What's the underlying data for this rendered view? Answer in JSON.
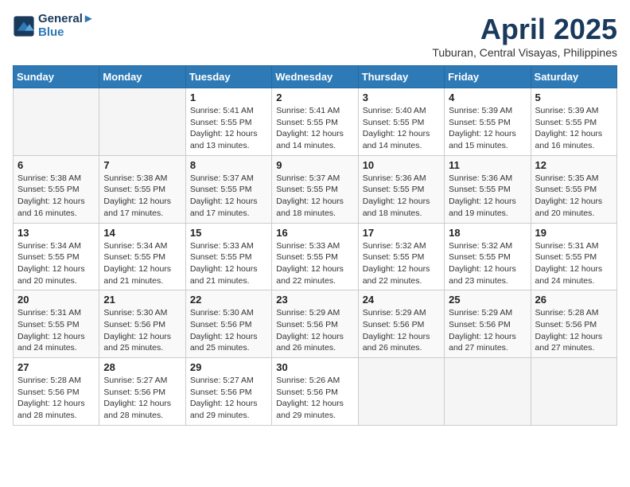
{
  "header": {
    "logo_line1": "General",
    "logo_line2": "Blue",
    "month": "April 2025",
    "location": "Tuburan, Central Visayas, Philippines"
  },
  "weekdays": [
    "Sunday",
    "Monday",
    "Tuesday",
    "Wednesday",
    "Thursday",
    "Friday",
    "Saturday"
  ],
  "weeks": [
    [
      {
        "day": "",
        "info": ""
      },
      {
        "day": "",
        "info": ""
      },
      {
        "day": "1",
        "info": "Sunrise: 5:41 AM\nSunset: 5:55 PM\nDaylight: 12 hours and 13 minutes."
      },
      {
        "day": "2",
        "info": "Sunrise: 5:41 AM\nSunset: 5:55 PM\nDaylight: 12 hours and 14 minutes."
      },
      {
        "day": "3",
        "info": "Sunrise: 5:40 AM\nSunset: 5:55 PM\nDaylight: 12 hours and 14 minutes."
      },
      {
        "day": "4",
        "info": "Sunrise: 5:39 AM\nSunset: 5:55 PM\nDaylight: 12 hours and 15 minutes."
      },
      {
        "day": "5",
        "info": "Sunrise: 5:39 AM\nSunset: 5:55 PM\nDaylight: 12 hours and 16 minutes."
      }
    ],
    [
      {
        "day": "6",
        "info": "Sunrise: 5:38 AM\nSunset: 5:55 PM\nDaylight: 12 hours and 16 minutes."
      },
      {
        "day": "7",
        "info": "Sunrise: 5:38 AM\nSunset: 5:55 PM\nDaylight: 12 hours and 17 minutes."
      },
      {
        "day": "8",
        "info": "Sunrise: 5:37 AM\nSunset: 5:55 PM\nDaylight: 12 hours and 17 minutes."
      },
      {
        "day": "9",
        "info": "Sunrise: 5:37 AM\nSunset: 5:55 PM\nDaylight: 12 hours and 18 minutes."
      },
      {
        "day": "10",
        "info": "Sunrise: 5:36 AM\nSunset: 5:55 PM\nDaylight: 12 hours and 18 minutes."
      },
      {
        "day": "11",
        "info": "Sunrise: 5:36 AM\nSunset: 5:55 PM\nDaylight: 12 hours and 19 minutes."
      },
      {
        "day": "12",
        "info": "Sunrise: 5:35 AM\nSunset: 5:55 PM\nDaylight: 12 hours and 20 minutes."
      }
    ],
    [
      {
        "day": "13",
        "info": "Sunrise: 5:34 AM\nSunset: 5:55 PM\nDaylight: 12 hours and 20 minutes."
      },
      {
        "day": "14",
        "info": "Sunrise: 5:34 AM\nSunset: 5:55 PM\nDaylight: 12 hours and 21 minutes."
      },
      {
        "day": "15",
        "info": "Sunrise: 5:33 AM\nSunset: 5:55 PM\nDaylight: 12 hours and 21 minutes."
      },
      {
        "day": "16",
        "info": "Sunrise: 5:33 AM\nSunset: 5:55 PM\nDaylight: 12 hours and 22 minutes."
      },
      {
        "day": "17",
        "info": "Sunrise: 5:32 AM\nSunset: 5:55 PM\nDaylight: 12 hours and 22 minutes."
      },
      {
        "day": "18",
        "info": "Sunrise: 5:32 AM\nSunset: 5:55 PM\nDaylight: 12 hours and 23 minutes."
      },
      {
        "day": "19",
        "info": "Sunrise: 5:31 AM\nSunset: 5:55 PM\nDaylight: 12 hours and 24 minutes."
      }
    ],
    [
      {
        "day": "20",
        "info": "Sunrise: 5:31 AM\nSunset: 5:55 PM\nDaylight: 12 hours and 24 minutes."
      },
      {
        "day": "21",
        "info": "Sunrise: 5:30 AM\nSunset: 5:56 PM\nDaylight: 12 hours and 25 minutes."
      },
      {
        "day": "22",
        "info": "Sunrise: 5:30 AM\nSunset: 5:56 PM\nDaylight: 12 hours and 25 minutes."
      },
      {
        "day": "23",
        "info": "Sunrise: 5:29 AM\nSunset: 5:56 PM\nDaylight: 12 hours and 26 minutes."
      },
      {
        "day": "24",
        "info": "Sunrise: 5:29 AM\nSunset: 5:56 PM\nDaylight: 12 hours and 26 minutes."
      },
      {
        "day": "25",
        "info": "Sunrise: 5:29 AM\nSunset: 5:56 PM\nDaylight: 12 hours and 27 minutes."
      },
      {
        "day": "26",
        "info": "Sunrise: 5:28 AM\nSunset: 5:56 PM\nDaylight: 12 hours and 27 minutes."
      }
    ],
    [
      {
        "day": "27",
        "info": "Sunrise: 5:28 AM\nSunset: 5:56 PM\nDaylight: 12 hours and 28 minutes."
      },
      {
        "day": "28",
        "info": "Sunrise: 5:27 AM\nSunset: 5:56 PM\nDaylight: 12 hours and 28 minutes."
      },
      {
        "day": "29",
        "info": "Sunrise: 5:27 AM\nSunset: 5:56 PM\nDaylight: 12 hours and 29 minutes."
      },
      {
        "day": "30",
        "info": "Sunrise: 5:26 AM\nSunset: 5:56 PM\nDaylight: 12 hours and 29 minutes."
      },
      {
        "day": "",
        "info": ""
      },
      {
        "day": "",
        "info": ""
      },
      {
        "day": "",
        "info": ""
      }
    ]
  ]
}
